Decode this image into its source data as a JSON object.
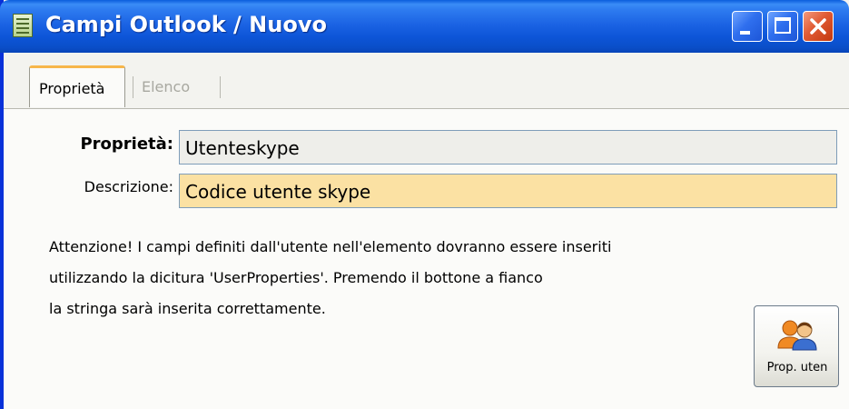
{
  "window": {
    "title": "Campi Outlook / Nuovo"
  },
  "tabs": [
    {
      "label": "Proprietà",
      "active": true
    },
    {
      "label": "Elenco",
      "active": false
    }
  ],
  "form": {
    "property_label": "Proprietà:",
    "property_value": "Utenteskype",
    "description_label": "Descrizione:",
    "description_value": "Codice utente skype"
  },
  "warning": {
    "line1": "Attenzione! I campi definiti dall'utente nell'elemento dovranno essere inseriti",
    "line2": "utilizzando la dicitura 'UserProperties'. Premendo il bottone a fianco",
    "line3": "la stringa sarà inserita correttamente."
  },
  "buttons": {
    "user_props_label": "Prop. uten",
    "user_props_icon": "users-icon"
  },
  "colors": {
    "titlebar": "#0a55d8",
    "description_field_bg": "#fbe1a3",
    "active_tab_accent": "#f7b64a"
  }
}
